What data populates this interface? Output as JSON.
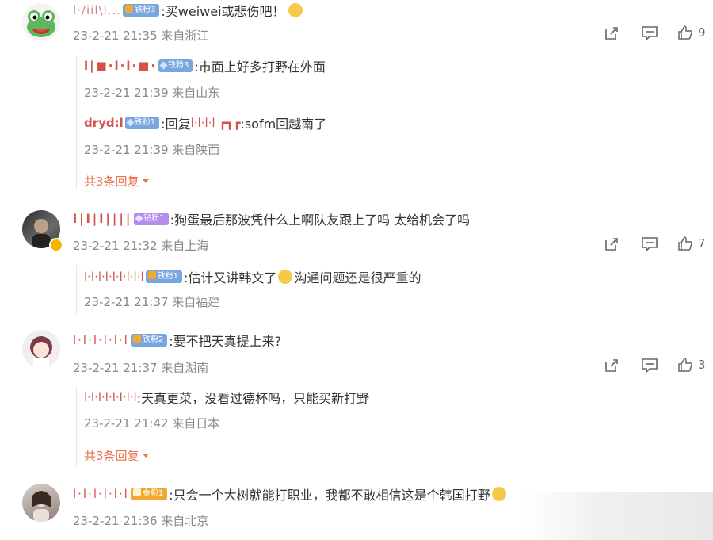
{
  "colors": {
    "orange": "#eb7350",
    "meta": "#888888",
    "text": "#333333",
    "iron": "#7aa6e0",
    "drill": "#b48cf0",
    "gold": "#f0a830"
  },
  "comments": [
    {
      "user": "l·/iil\\l...",
      "badge": "铁粉3",
      "text": ":买weiwei或悲伤吧！",
      "meta": "23-2-21 21:35 来自浙江",
      "likes": "9",
      "replies": [
        {
          "user": "l|■·l·l·■·",
          "badge": "铁粉3",
          "text": ":市面上好多打野在外面",
          "meta": "23-2-21 21:39 来自山东"
        },
        {
          "user": "dryd:l",
          "badge": "铁粉1",
          "text": ":回复",
          "reply_target": "l·l·l·l ┏┓┏",
          "text2": ":sofm回越南了",
          "meta": "23-2-21 21:39 来自陕西"
        }
      ],
      "more": "共3条回复"
    },
    {
      "user": "l|l|l||||",
      "badge": "钻粉1",
      "text": ":狗蛋最后那波凭什么上啊队友跟上了吗 太给机会了吗",
      "meta": "23-2-21 21:32 来自上海",
      "likes": "7",
      "replies": [
        {
          "user": "l·l·l·l·l·l·l·l·l",
          "badge": "铁粉1",
          "text": ":估计又讲韩文了",
          "text2": "沟通问题还是很严重的",
          "meta": "23-2-21 21:37 来自福建"
        }
      ]
    },
    {
      "user": "l·l·l·l·l·l",
      "badge": "铁粉2",
      "text": ":要不把天真提上来?",
      "meta": "23-2-21 21:37 来自湖南",
      "likes": "3",
      "replies": [
        {
          "user": "l·l·l·l·l·l·l·l",
          "text": ":天真更菜，没看过德杯吗，只能买新打野",
          "meta": "23-2-21 21:42 来自日本"
        }
      ],
      "more": "共3条回复"
    },
    {
      "user": "l·l·l·l·l·l",
      "badge": "金粉1",
      "text": ":只会一个大树就能打职业，我都不敢相信这是个韩国打野",
      "meta": "23-2-21 21:36 来自北京"
    }
  ],
  "icons": {
    "share": "share-icon",
    "comment": "comment-icon",
    "like": "thumbs-up-icon",
    "more": "caret-down-icon"
  }
}
